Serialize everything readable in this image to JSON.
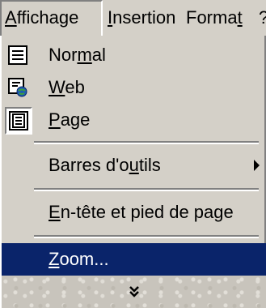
{
  "menubar": {
    "items": [
      {
        "pre": "",
        "key": "A",
        "post": "ffichage"
      },
      {
        "pre": "",
        "key": "I",
        "post": "nsertion"
      },
      {
        "pre": "Forma",
        "key": "t",
        "post": ""
      },
      {
        "pre": "",
        "key": "",
        "post": "?"
      }
    ]
  },
  "dropdown": {
    "normal": {
      "pre": "Nor",
      "key": "m",
      "post": "al",
      "icon": "normal-view-icon"
    },
    "web": {
      "pre": "",
      "key": "W",
      "post": "eb",
      "icon": "web-layout-icon"
    },
    "page": {
      "pre": "",
      "key": "P",
      "post": "age",
      "icon": "page-layout-icon"
    },
    "toolbars": {
      "pre": "Barres d'o",
      "key": "u",
      "post": "tils",
      "submenu_icon": "submenu-arrow-icon"
    },
    "header_footer": {
      "pre": "",
      "key": "E",
      "post": "n-tête et pied de page"
    },
    "zoom": {
      "pre": "",
      "key": "Z",
      "post": "oom..."
    },
    "expand_icon": "expand-chevrons-icon"
  },
  "colors": {
    "menu_bg": "#d4d0c8",
    "highlight_bg": "#0a246a",
    "highlight_text": "#ffffff"
  }
}
